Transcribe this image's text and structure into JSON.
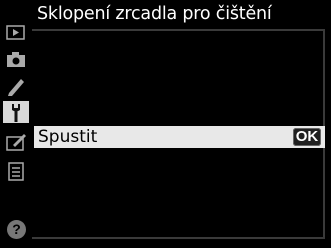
{
  "header": {
    "title": "Sklopení zrcadla pro čištění"
  },
  "sidebar": {
    "tabs": [
      {
        "icon": "playback-icon"
      },
      {
        "icon": "camera-icon"
      },
      {
        "icon": "pencil-icon"
      },
      {
        "icon": "wrench-icon",
        "active": true
      },
      {
        "icon": "retouch-icon"
      },
      {
        "icon": "my-menu-icon"
      }
    ],
    "help_label": "?"
  },
  "menu": {
    "items": [
      {
        "label": "Spustit",
        "action_label": "OK",
        "selected": true
      }
    ]
  },
  "colors": {
    "background": "#000000",
    "highlight": "#e8e8e8",
    "active_tab": "#d8d8d8"
  }
}
